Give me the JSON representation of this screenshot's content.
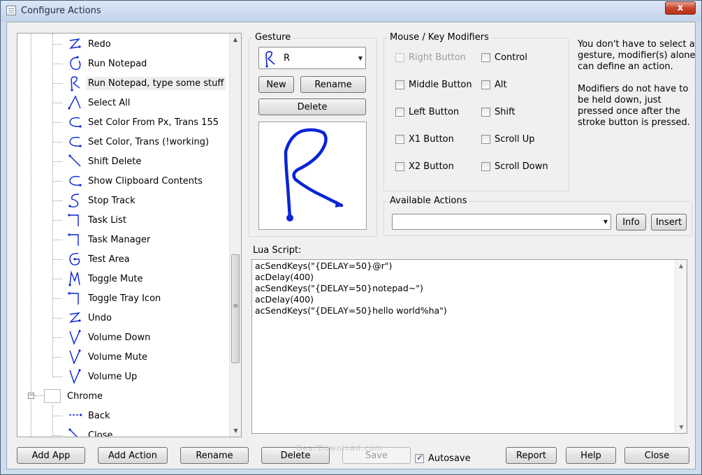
{
  "window": {
    "title": "Configure Actions",
    "close_glyph": "x"
  },
  "tree": {
    "items": [
      {
        "label": "Redo",
        "icon": "gesture-z-icon"
      },
      {
        "label": "Run Notepad",
        "icon": "gesture-circle-icon"
      },
      {
        "label": "Run Notepad, type some stuff",
        "icon": "gesture-r-icon",
        "selected": true
      },
      {
        "label": "Select All",
        "icon": "gesture-caret-icon"
      },
      {
        "label": "Set Color From Px, Trans 155",
        "icon": "gesture-c-icon"
      },
      {
        "label": "Set Color, Trans (!working)",
        "icon": "gesture-c-icon"
      },
      {
        "label": "Shift Delete",
        "icon": "gesture-diagonal-icon"
      },
      {
        "label": "Show Clipboard Contents",
        "icon": "gesture-c-icon"
      },
      {
        "label": "Stop Track",
        "icon": "gesture-s-icon"
      },
      {
        "label": "Task List",
        "icon": "gesture-hook-icon"
      },
      {
        "label": "Task Manager",
        "icon": "gesture-hook-icon"
      },
      {
        "label": "Test Area",
        "icon": "gesture-g-icon"
      },
      {
        "label": "Toggle Mute",
        "icon": "gesture-m-icon"
      },
      {
        "label": "Toggle Tray Icon",
        "icon": "gesture-hook-icon"
      },
      {
        "label": "Undo",
        "icon": "gesture-z-icon"
      },
      {
        "label": "Volume Down",
        "icon": "gesture-v-icon"
      },
      {
        "label": "Volume Mute",
        "icon": "gesture-v-icon"
      },
      {
        "label": "Volume Up",
        "icon": "gesture-v-icon"
      }
    ],
    "app_node": {
      "label": "Chrome",
      "expander": "−"
    },
    "app_children": [
      {
        "label": "Back",
        "icon": "gesture-line-icon"
      },
      {
        "label": "Close",
        "icon": "gesture-diagonal-icon"
      }
    ]
  },
  "gesture": {
    "group_title": "Gesture",
    "selected_value": "R",
    "new_label": "New",
    "rename_label": "Rename",
    "delete_label": "Delete"
  },
  "modifiers": {
    "group_title": "Mouse / Key Modifiers",
    "left_column": [
      {
        "label": "Right Button",
        "disabled": true
      },
      {
        "label": "Middle Button"
      },
      {
        "label": "Left Button"
      },
      {
        "label": "X1 Button"
      },
      {
        "label": "X2 Button"
      }
    ],
    "right_column": [
      {
        "label": "Control"
      },
      {
        "label": "Alt"
      },
      {
        "label": "Shift"
      },
      {
        "label": "Scroll Up"
      },
      {
        "label": "Scroll Down"
      }
    ]
  },
  "info": {
    "paragraph1": "You don't have to select a gesture, modifier(s) alone can define an action.",
    "paragraph2": "Modifiers do not have to be held down, just pressed once after the stroke button is pressed."
  },
  "available_actions": {
    "group_title": "Available Actions",
    "selected_value": "",
    "info_label": "Info",
    "insert_label": "Insert"
  },
  "lua": {
    "label": "Lua Script:",
    "lines": [
      "acSendKeys(\"{DELAY=50}@r\")",
      "acDelay(400)",
      "acSendKeys(\"{DELAY=50}notepad~\")",
      "acDelay(400)",
      "acSendKeys(\"{DELAY=50}hello world%ha\")"
    ]
  },
  "footer": {
    "add_app": "Add App",
    "add_action": "Add Action",
    "rename": "Rename",
    "delete": "Delete",
    "save": "Save",
    "autosave": "Autosave",
    "autosave_checked": true,
    "report": "Report",
    "help": "Help",
    "close": "Close"
  },
  "watermark": "GearDownload.com",
  "colors": {
    "gesture_stroke": "#0a24d6",
    "window_bg": "#f0f0f0"
  }
}
